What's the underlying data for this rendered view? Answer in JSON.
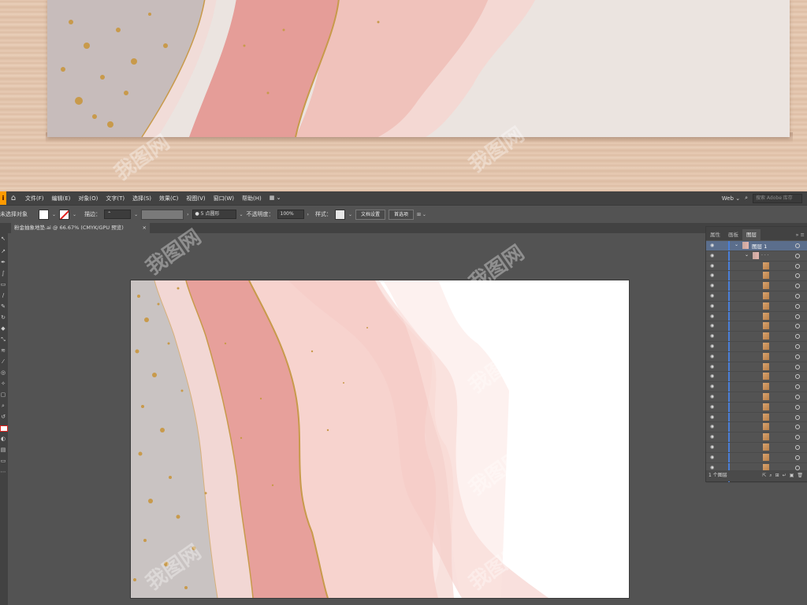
{
  "menubar": {
    "logo": "i",
    "items": [
      "文件(F)",
      "编辑(E)",
      "对象(O)",
      "文字(T)",
      "选择(S)",
      "效果(C)",
      "视图(V)",
      "窗口(W)",
      "帮助(H)"
    ],
    "workspace": "Web",
    "search_placeholder": "搜索 Adobe 库存"
  },
  "controlbar": {
    "selection": "未选择对象",
    "stroke_label": "描边：",
    "brush": "5 点圆形",
    "opacity_label": "不透明度：",
    "opacity_value": "100%",
    "style_label": "样式：",
    "doc_setup": "文档设置",
    "preferences": "首选项"
  },
  "tab": {
    "title": "粉金抽象地垫.ai @ 66.67% (CMYK/GPU 预览)",
    "close": "×"
  },
  "panel": {
    "tabs": [
      "属性",
      "画板",
      "图层"
    ],
    "active_tab": "图层",
    "layer_name": "图层 1",
    "footer": "1 个图层"
  },
  "watermark": "我图网",
  "colors": {
    "gray": "#c9c3c2",
    "rose": "#e59d98",
    "blush": "#f2c3bd",
    "gold": "#c89a4b",
    "layer_highlight": "#5b6e8c"
  }
}
